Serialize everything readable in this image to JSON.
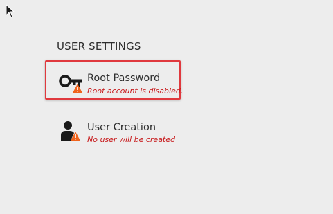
{
  "user_settings": {
    "heading": "USER SETTINGS",
    "spokes": [
      {
        "title": "Root Password",
        "status": "Root account is disabled.",
        "icon": "key-warning-icon",
        "selected": true
      },
      {
        "title": "User Creation",
        "status": "No user will be created",
        "icon": "user-warning-icon",
        "selected": false
      }
    ]
  },
  "colors": {
    "background": "#ededed",
    "status_text": "#c7181a",
    "selection_border": "#e0393e",
    "warning": "#f0631c"
  }
}
